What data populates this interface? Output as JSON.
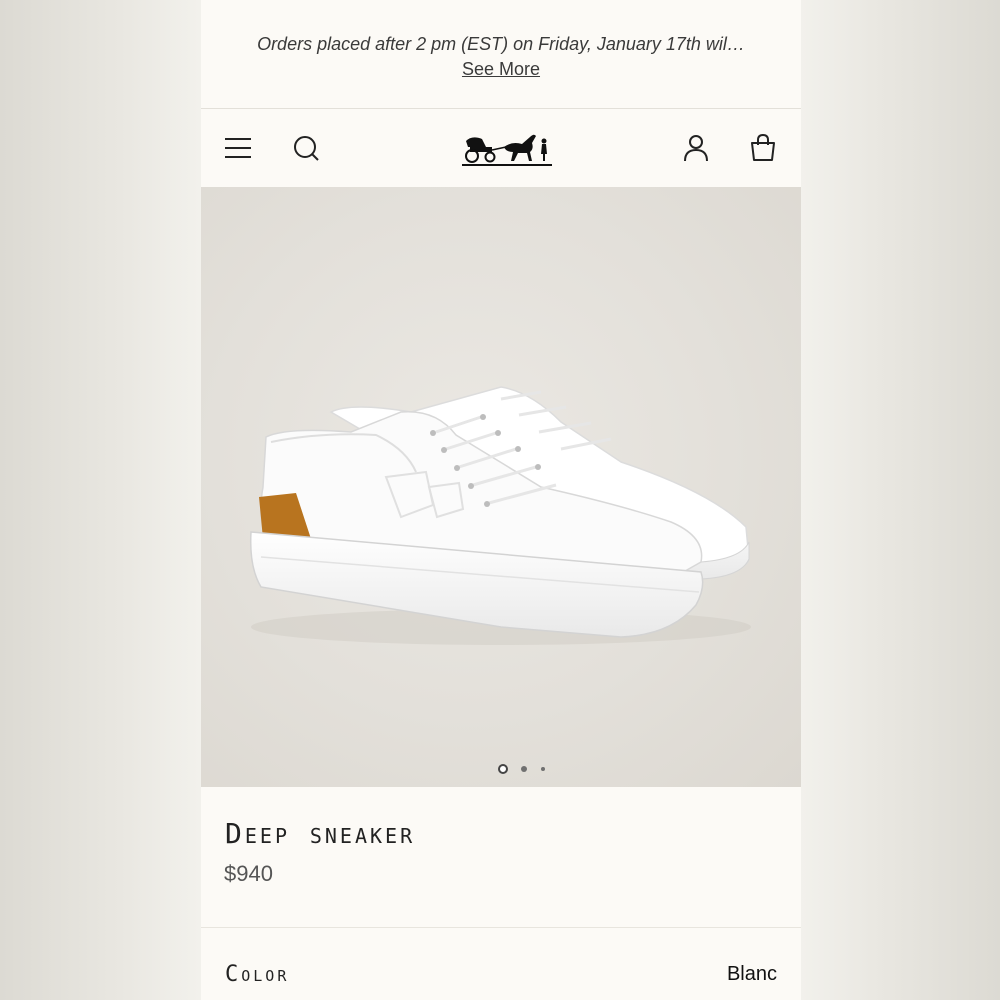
{
  "banner": {
    "text": "Orders placed after 2 pm (EST) on Friday, January 17th wil…",
    "link": "See More"
  },
  "header": {
    "icons": [
      "menu-icon",
      "search-icon",
      "brand-logo",
      "account-icon",
      "shopping-bag-icon"
    ]
  },
  "gallery": {
    "image": "white leather low-top sneaker with tan heel tab",
    "pagination": {
      "current": 1,
      "total": 3
    }
  },
  "product": {
    "name": "Deep sneaker",
    "price": "$940",
    "color_label": "Color",
    "color_value": "Blanc"
  },
  "colors": {
    "background": "#fcfaf6",
    "heel_tab": "#b8741f",
    "text": "#222222"
  }
}
